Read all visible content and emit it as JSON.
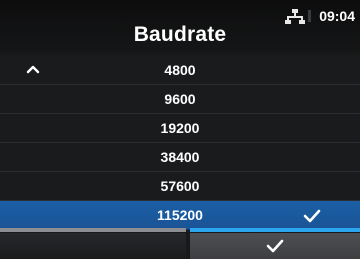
{
  "header": {
    "title": "Baudrate",
    "time": "09:04",
    "network_icon": "network-icon"
  },
  "list": {
    "scroll_up_icon": "chevron-up-icon",
    "items": [
      {
        "label": "4800",
        "selected": false
      },
      {
        "label": "9600",
        "selected": false
      },
      {
        "label": "19200",
        "selected": false
      },
      {
        "label": "38400",
        "selected": false
      },
      {
        "label": "57600",
        "selected": false
      },
      {
        "label": "115200",
        "selected": true
      }
    ],
    "selected_icon": "checkmark-icon"
  },
  "footer": {
    "left_button_label": "",
    "right_button_icon": "checkmark-icon"
  },
  "colors": {
    "selected_row": "#1a5a9e",
    "footer_accent": "#2ca6ee",
    "background": "#18191b"
  }
}
